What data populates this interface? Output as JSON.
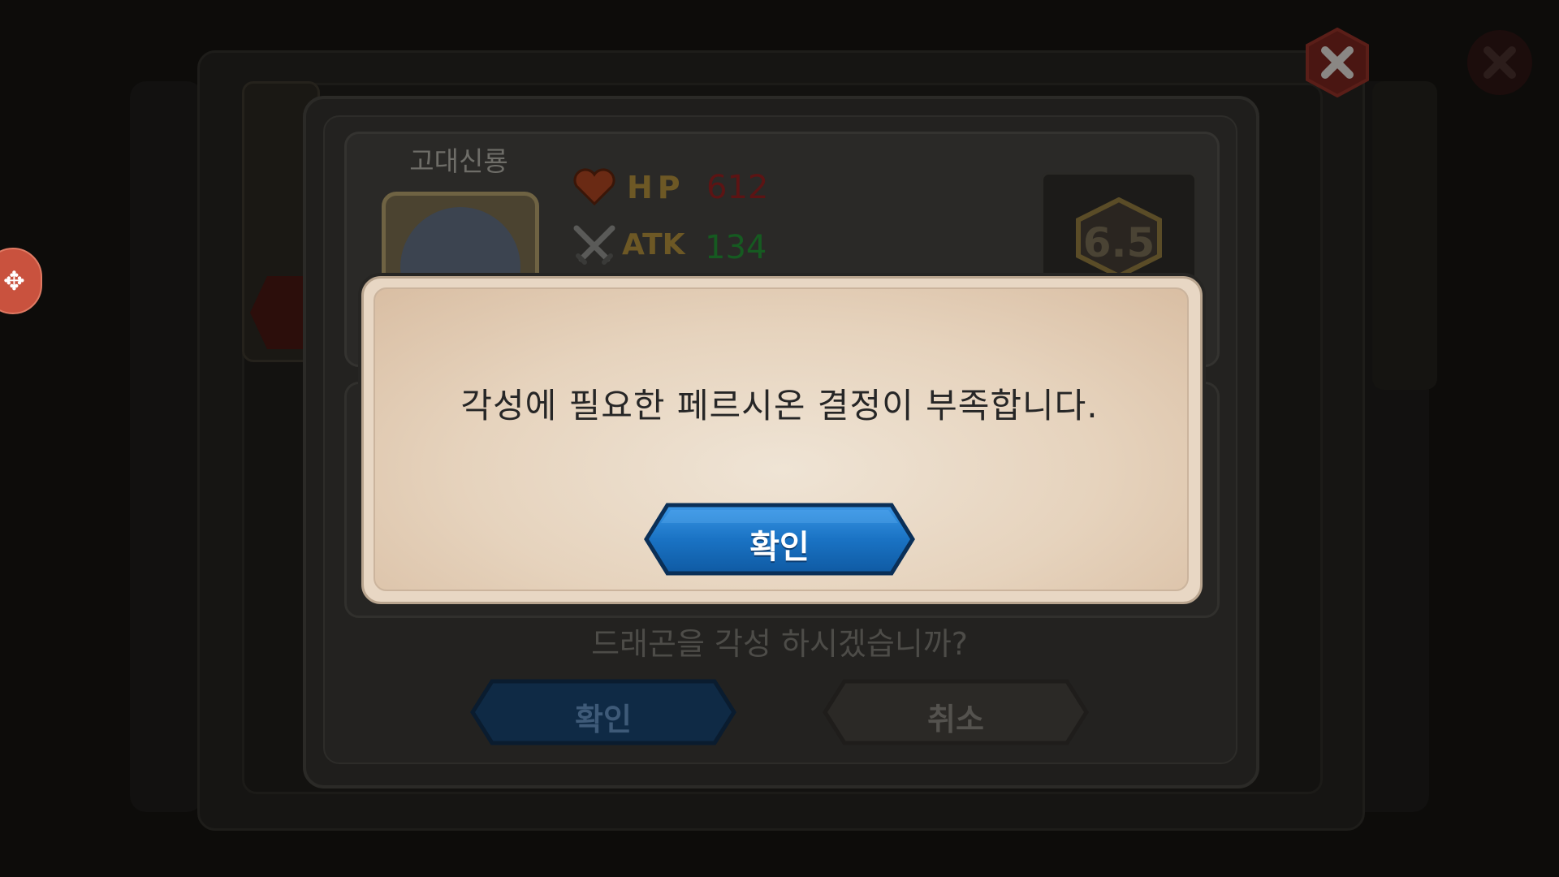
{
  "background": {
    "dragon_name": "고대신룡",
    "stats": {
      "hp_label": "HP",
      "hp_value": "612",
      "atk_label": "ATK",
      "atk_value": "134"
    },
    "grade": "6.5",
    "question": "드래곤을 각성 하시겠습니까?",
    "confirm_label": "확인",
    "cancel_label": "취소"
  },
  "alert": {
    "message": "각성에 필요한 페르시온 결정이 부족합니다.",
    "confirm_label": "확인"
  },
  "colors": {
    "alert_button": "#1a73c4",
    "alert_panel": "#e8d7c4",
    "hp_value": "#5c1414",
    "atk_value": "#165a21",
    "close_button": "#c0392b"
  },
  "icons": [
    "heart-icon",
    "crossed-swords-icon",
    "hexagon-grade-icon",
    "close-icon",
    "dragon-portrait",
    "tool-icon"
  ]
}
